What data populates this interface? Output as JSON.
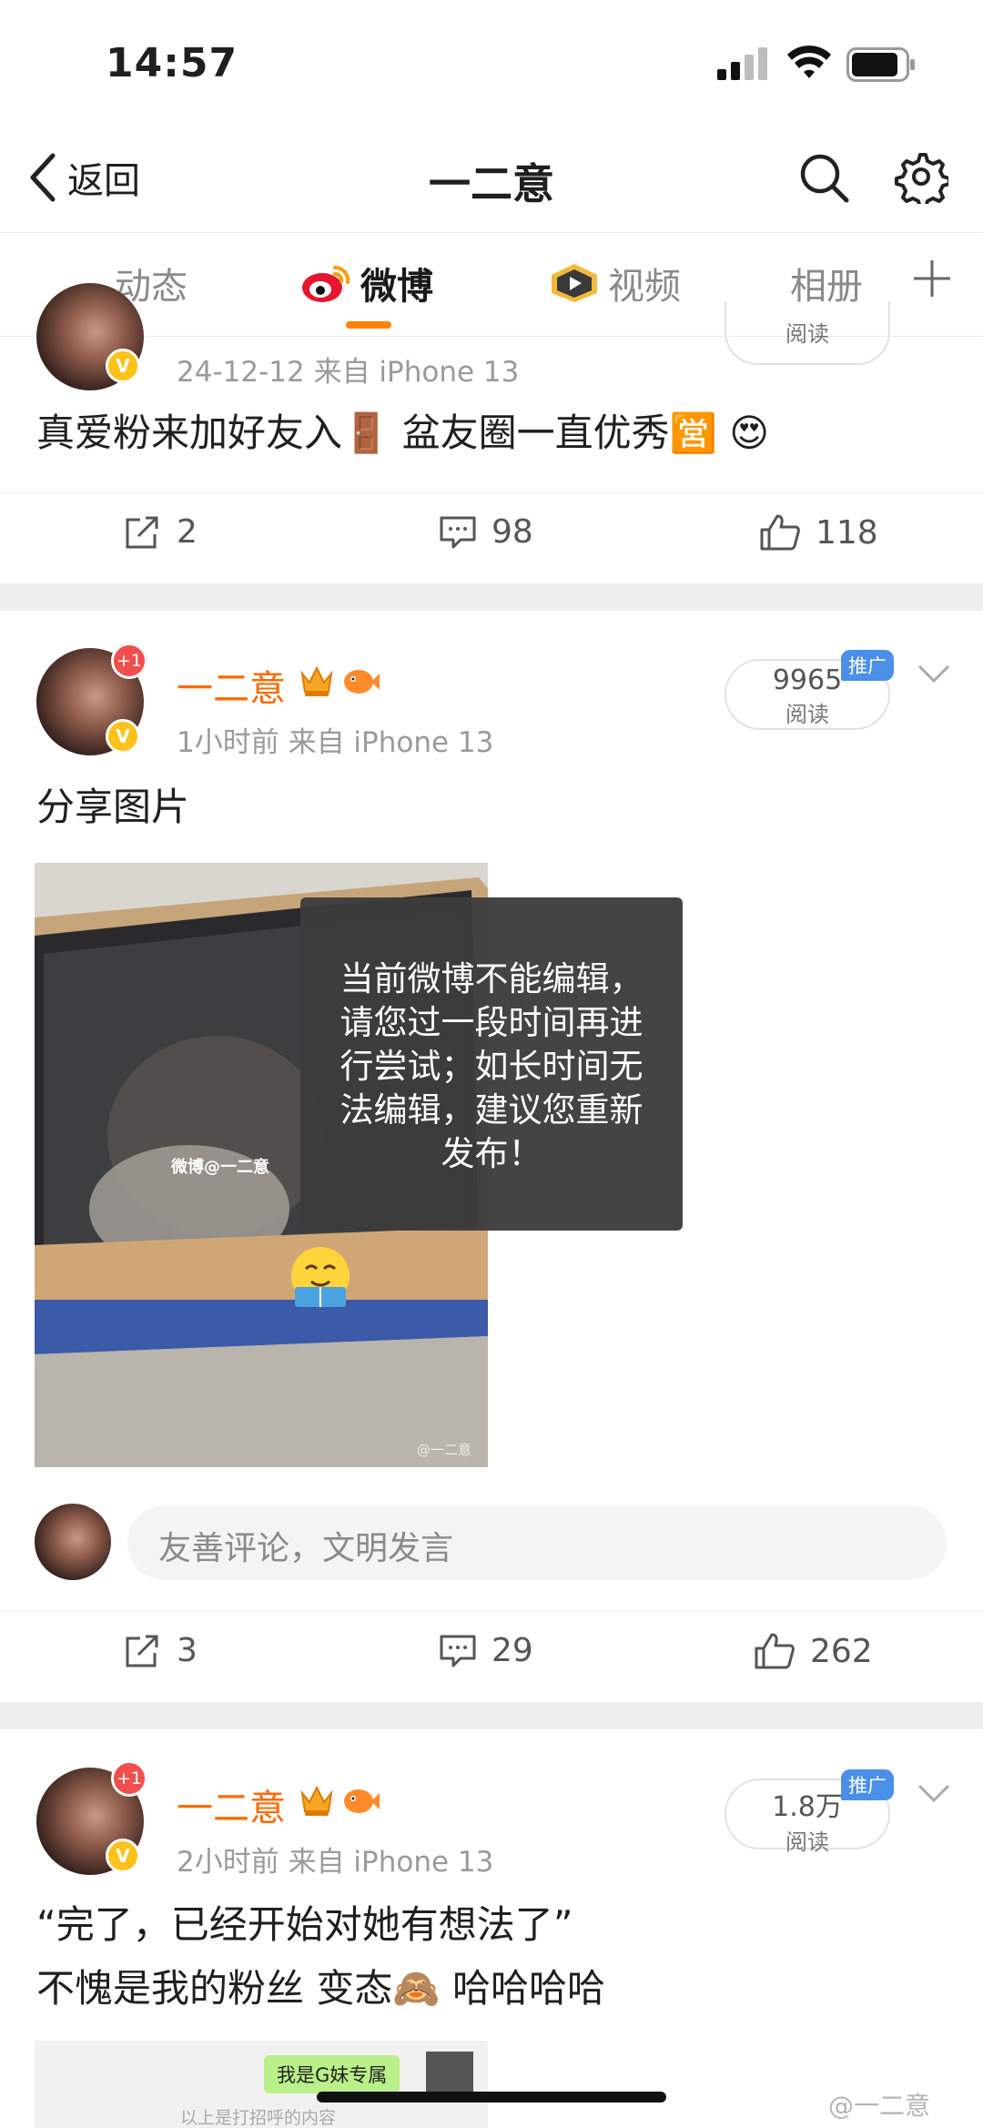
{
  "status_bar": {
    "time": "14:57"
  },
  "header": {
    "back_label": "返回",
    "title": "一二意"
  },
  "tabs": [
    {
      "label": "动态",
      "active": false
    },
    {
      "label": "微博",
      "active": true
    },
    {
      "label": "视频",
      "active": false
    },
    {
      "label": "相册",
      "active": false
    }
  ],
  "posts": [
    {
      "meta": "24-12-12  来自 iPhone 13",
      "reads_label": "阅读",
      "text": "真爱粉来加好友入🚪  盆友圈一直优秀🈺 😍",
      "shares": "2",
      "comments": "98",
      "likes": "118"
    },
    {
      "username": "一二意",
      "meta": "1小时前  来自 iPhone 13",
      "reads": "9965",
      "reads_label": "阅读",
      "promo": "推广",
      "avatar_badge": "+1",
      "text": "分享图片",
      "image_watermark": "微博@一二意",
      "image_corner_wm": "@一二意",
      "comment_placeholder": "友善评论，文明发言",
      "shares": "3",
      "comments": "29",
      "likes": "262"
    },
    {
      "username": "一二意",
      "meta": "2小时前  来自 iPhone 13",
      "reads": "1.8万",
      "reads_label": "阅读",
      "promo": "推广",
      "avatar_badge": "+1",
      "text_line1": "“完了，已经开始对她有想法了”",
      "text_line2": "不愧是我的粉丝 变态🙈 哈哈哈哈",
      "thumb_caption": "我是G妹专属",
      "thumb_text": "以上是打招呼的内容"
    }
  ],
  "toast": {
    "line1": "当前微博不能编辑，",
    "line2": "请您过一段时间再进",
    "line3": "行尝试；如长时间无",
    "line4": "法编辑，建议您重新",
    "line5": "发布！"
  },
  "watermark": "@一二意",
  "colors": {
    "accent": "#ff8200",
    "username": "#ff6a00",
    "promo": "#4a8fe8"
  }
}
